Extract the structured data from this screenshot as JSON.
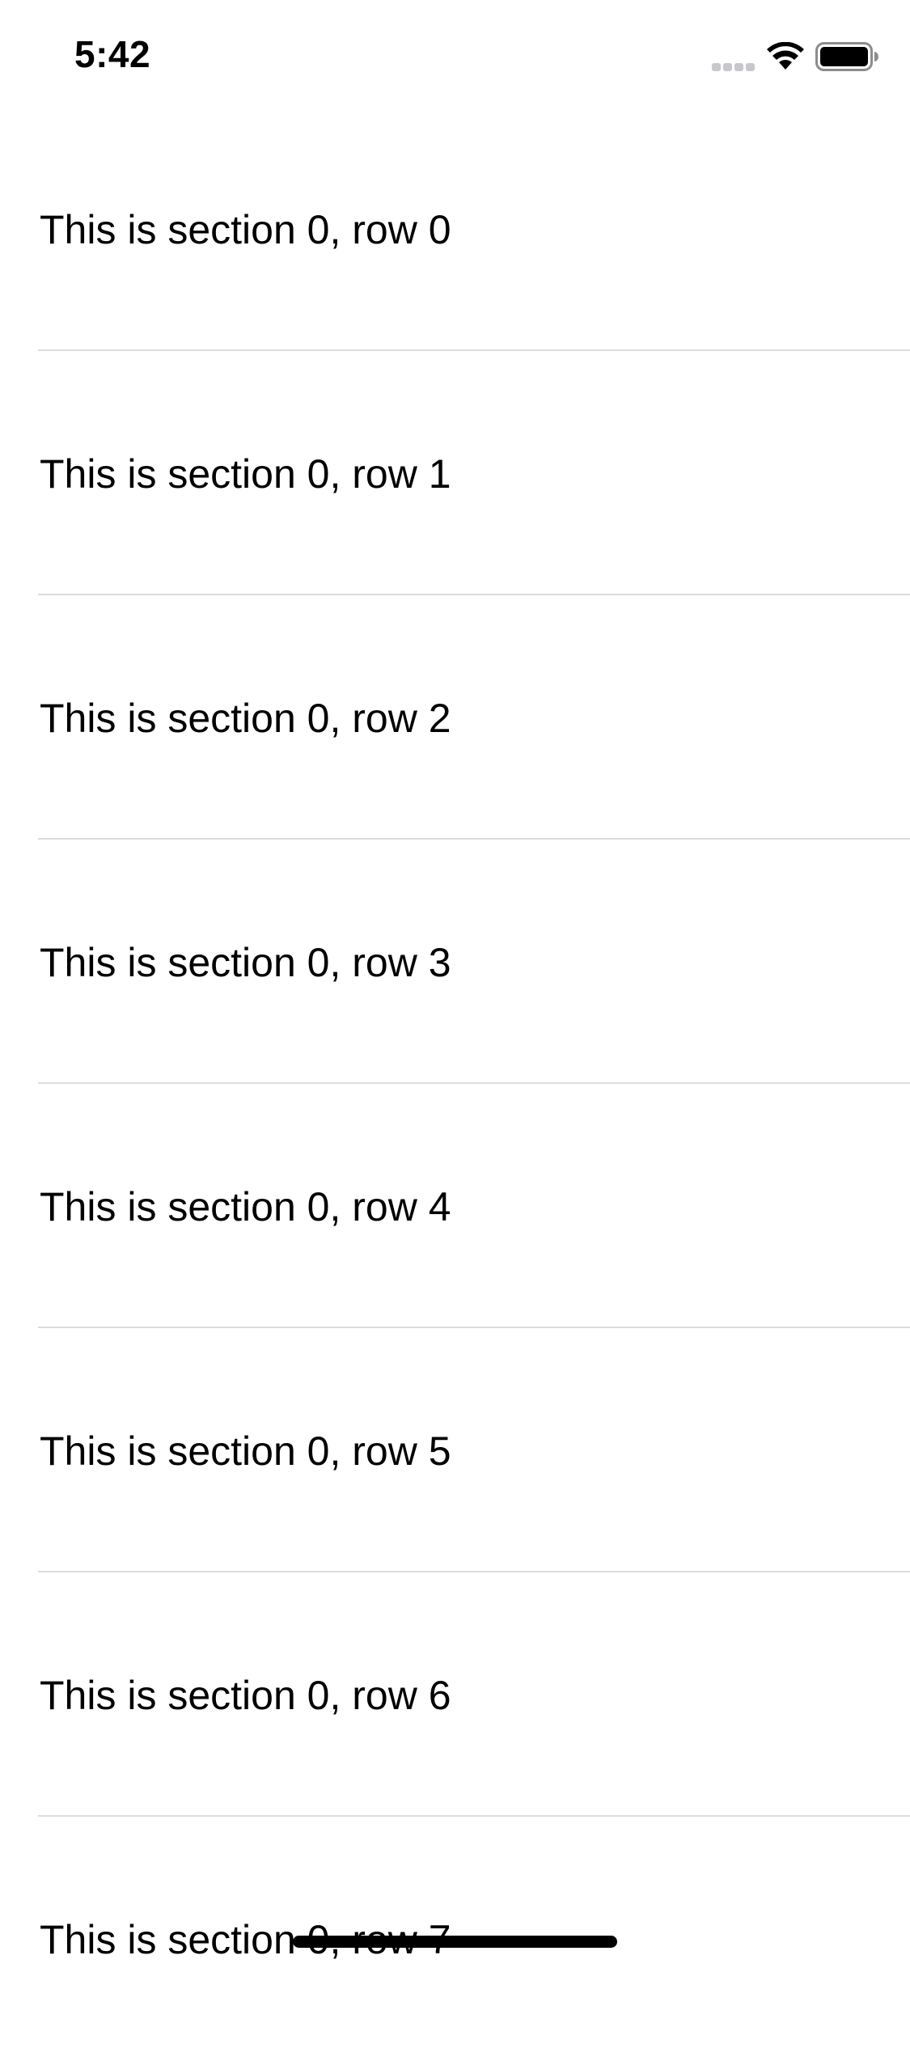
{
  "status_bar": {
    "time": "5:42",
    "signal_icon": "cellular-signal-icon",
    "wifi_icon": "wifi-icon",
    "battery_icon": "battery-icon"
  },
  "table": {
    "rows": [
      {
        "label": "This is section 0, row 0"
      },
      {
        "label": "This is section 0, row 1"
      },
      {
        "label": "This is section 0, row 2"
      },
      {
        "label": "This is section 0, row 3"
      },
      {
        "label": "This is section 0, row 4"
      },
      {
        "label": "This is section 0, row 5"
      },
      {
        "label": "This is section 0, row 6"
      },
      {
        "label": "This is section 0, row 7"
      }
    ]
  },
  "colors": {
    "background": "#ffffff",
    "text": "#000000",
    "separator": "#dcdce0"
  }
}
